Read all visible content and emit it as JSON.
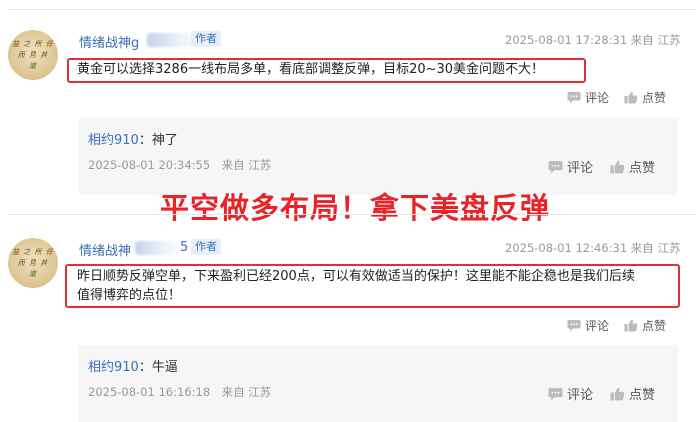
{
  "comments": [
    {
      "author_visible": "情绪战神g",
      "author_visible_b": "情绪战神",
      "badge": "作者",
      "avatar_lines": [
        "益 之 所 任",
        "而 見 其 ",
        "道"
      ],
      "meta": "2025-08-01 17:28:31 来自 江苏",
      "content": "黄金可以选择3286一线布局多单，看底部调整反弹，目标20~30美金问题不大！",
      "comment_label": "评论",
      "like_label": "点赞",
      "reply": {
        "user": "相约910",
        "text": "：神了",
        "meta": "2025-08-01 20:34:55　来自 江苏",
        "comment_label": "评论",
        "like_label": "点赞"
      }
    },
    {
      "author_visible": "情绪战神",
      "author_suffix": "5",
      "badge": "作者",
      "avatar_lines": [
        "益 之 所 任",
        "而 見 其 ",
        "道"
      ],
      "meta": "2025-08-01 12:46:31 来自 江苏",
      "content_line1": "昨日顺势反弹空单，下来盈利已经200点，可以有效做适当的保护！这里能不能企稳也是我们后续",
      "content_line2": "值得博弈的点位！",
      "comment_label": "评论",
      "like_label": "点赞",
      "reply": {
        "user": "相约910",
        "text": "：牛逼",
        "meta": "2025-08-01 16:16:18　来自 江苏",
        "comment_label": "评论",
        "like_label": "点赞"
      }
    }
  ],
  "overlay": {
    "headline": "平空做多布局！拿下美盘反弹",
    "color": "#e8242a"
  },
  "colors": {
    "link": "#3b6fb6",
    "highlight_border": "#e03030",
    "meta": "#999999",
    "reply_bg": "#f6f6f6"
  },
  "icons": {
    "comment": "comment-bubble-icon",
    "like": "thumbs-up-icon"
  }
}
